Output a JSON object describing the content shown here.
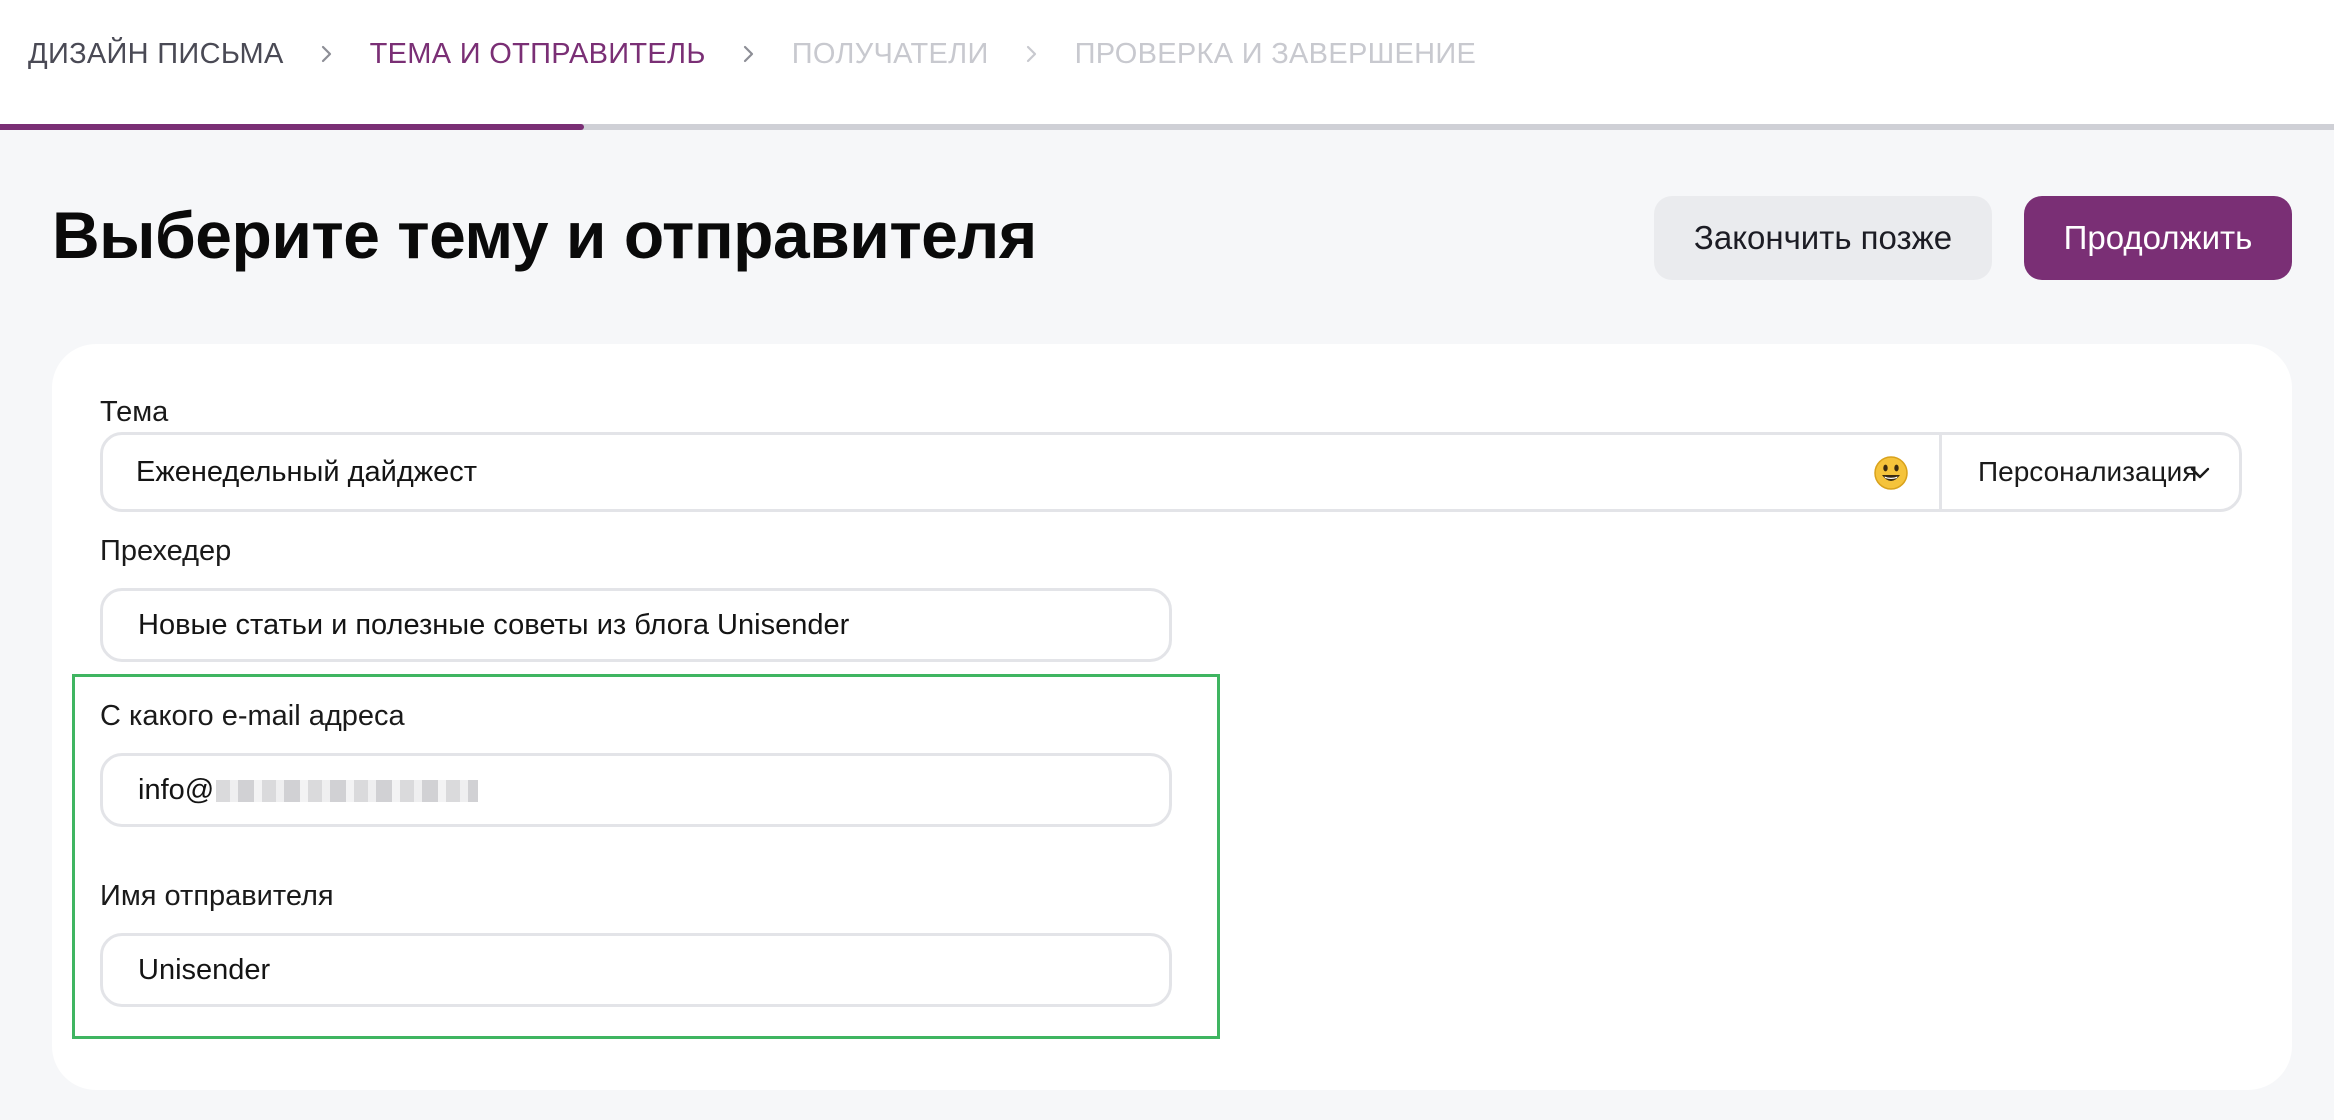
{
  "stepper": {
    "steps": [
      {
        "label": "ДИЗАЙН ПИСЬМА",
        "state": "done"
      },
      {
        "label": "ТЕМА И ОТПРАВИТЕЛЬ",
        "state": "active"
      },
      {
        "label": "ПОЛУЧАТЕЛИ",
        "state": "todo"
      },
      {
        "label": "ПРОВЕРКА И ЗАВЕРШЕНИЕ",
        "state": "todo"
      }
    ],
    "progress_fraction": 0.25
  },
  "header": {
    "title": "Выберите тему и отправителя",
    "finish_later_label": "Закончить позже",
    "continue_label": "Продолжить"
  },
  "form": {
    "subject_label": "Тема",
    "subject_value": "Еженедельный дайджест",
    "emoji_icon": "smiley-emoji-icon",
    "personalization_label": "Персонализация",
    "preheader_label": "Прехедер",
    "preheader_value": "Новые статьи и полезные советы из блога Unisender",
    "from_email_label": "С какого e-mail адреса",
    "from_email_value": "info@",
    "sender_name_label": "Имя отправителя",
    "sender_name_value": "Unisender"
  },
  "colors": {
    "accent": "#7a2f75",
    "highlight": "#3fb561",
    "muted_step": "#c8c9cf"
  }
}
